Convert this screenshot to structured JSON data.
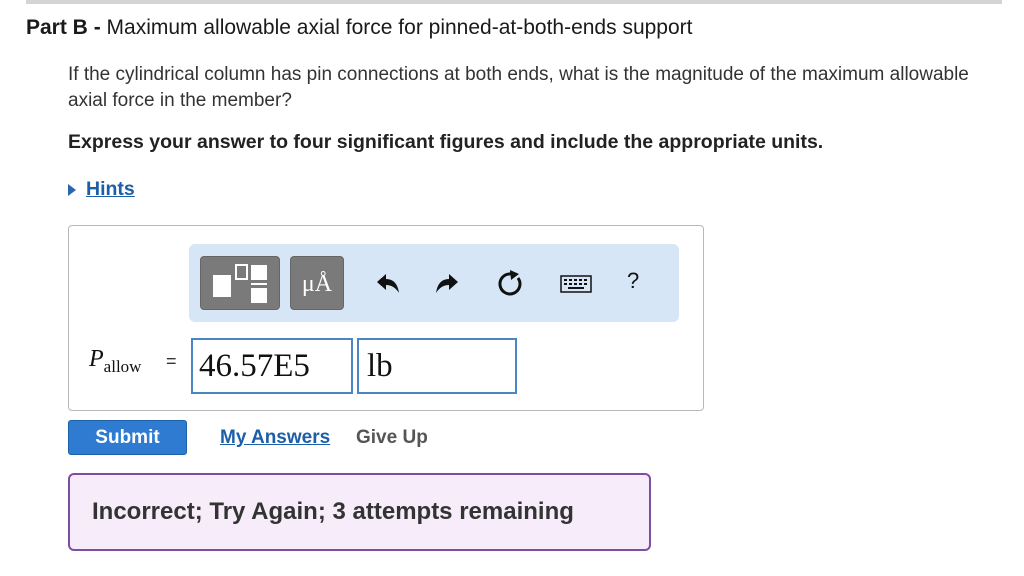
{
  "part": {
    "prefix": "Part B",
    "separator": " - ",
    "title": "Maximum allowable axial force for pinned-at-both-ends support"
  },
  "question": "If the cylindrical column has pin connections at both ends, what is the magnitude of the maximum allowable axial force in the member?",
  "instruction": "Express your answer to four significant figures and include the appropriate units.",
  "hints": {
    "label": "Hints"
  },
  "toolbar": {
    "templates_icon": "fraction-template-icon",
    "units_label": "μÅ",
    "undo_icon": "undo-icon",
    "redo_icon": "redo-icon",
    "reset_icon": "reset-icon",
    "keyboard_icon": "keyboard-icon",
    "help_label": "?"
  },
  "answer": {
    "variable": "P",
    "subscript": "allow",
    "equals": "=",
    "value": "46.57E5",
    "unit": "lb"
  },
  "actions": {
    "submit_label": "Submit",
    "my_answers_label": "My Answers",
    "give_up_label": "Give Up"
  },
  "feedback": {
    "message": "Incorrect; Try Again; 3 attempts remaining"
  },
  "colors": {
    "link": "#1c5fa8",
    "submit_bg": "#2e7bd1",
    "toolbar_bg": "#d7e6f7",
    "input_border": "#4a86c5",
    "feedback_border": "#7e4ea3",
    "feedback_bg": "#f6ecfa"
  }
}
